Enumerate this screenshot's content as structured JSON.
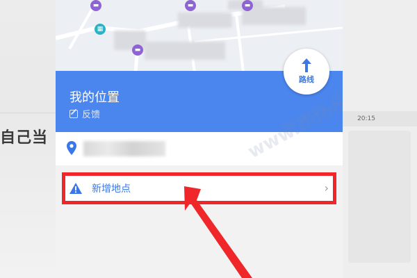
{
  "backdrop": {
    "left_text": "自己当",
    "right_time": "20:15"
  },
  "location_card": {
    "title": "我的位置",
    "feedback_label": "反馈",
    "route_button_label": "路线"
  },
  "add_place": {
    "label": "新增地点",
    "chevron": "›"
  },
  "colors": {
    "header_blue": "#4a86ee",
    "link_blue": "#3b78e7",
    "highlight_red": "#f0272a"
  }
}
